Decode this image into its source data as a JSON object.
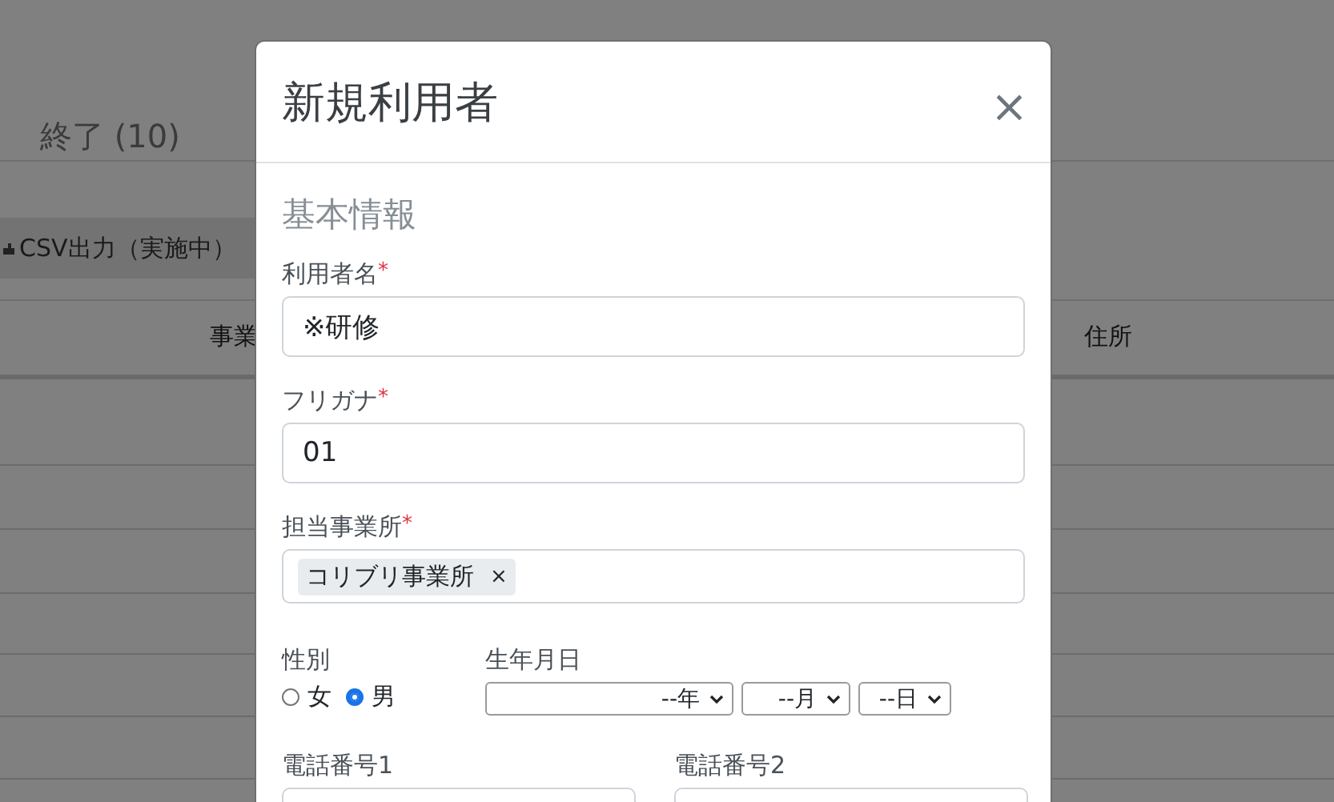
{
  "background": {
    "tab_label": "終了 (10)",
    "csv_button": "CSV出力（実施中）",
    "table": {
      "columns": [
        "事業",
        "住所"
      ]
    }
  },
  "modal": {
    "title": "新規利用者",
    "close": "×",
    "section_title": "基本情報",
    "fields": [
      {
        "label": "利用者名",
        "required_mark": "*",
        "value": "※研修"
      },
      {
        "label": "フリガナ",
        "required_mark": "*",
        "value": "01"
      }
    ],
    "office": {
      "label": "担当事業所",
      "required_mark": "*",
      "tags": [
        "コリブリ事業所"
      ],
      "remove_mark": "×"
    },
    "gender": {
      "label": "性別",
      "options": [
        {
          "label": "女",
          "selected": false
        },
        {
          "label": "男",
          "selected": true
        }
      ]
    },
    "birthdate": {
      "label": "生年月日",
      "selects": [
        "--年",
        "--月",
        "--日"
      ]
    },
    "phones": [
      {
        "label": "電話番号1"
      },
      {
        "label": "電話番号2"
      }
    ]
  }
}
